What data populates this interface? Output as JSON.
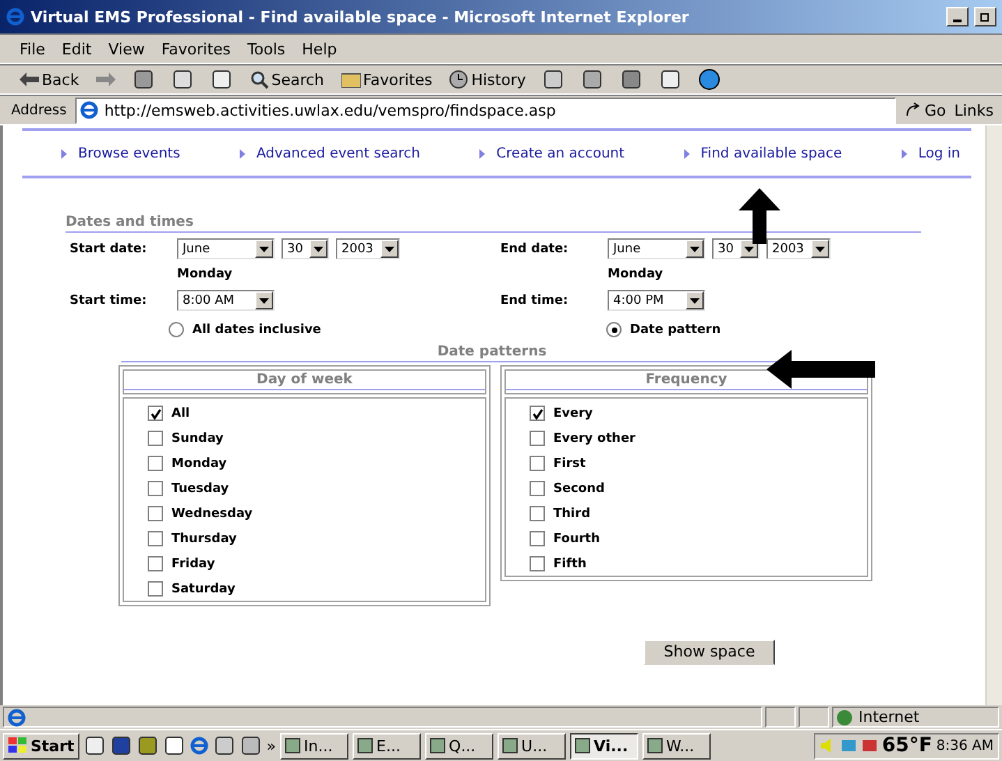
{
  "window": {
    "title": "Virtual EMS Professional - Find available space - Microsoft Internet Explorer"
  },
  "menu": [
    "File",
    "Edit",
    "View",
    "Favorites",
    "Tools",
    "Help"
  ],
  "toolbar": [
    {
      "kind": "back",
      "label": "Back"
    },
    {
      "kind": "search",
      "label": "Search"
    },
    {
      "kind": "favorites",
      "label": "Favorites"
    },
    {
      "kind": "history",
      "label": "History"
    }
  ],
  "address": {
    "label": "Address",
    "url": "http://emsweb.activities.uwlax.edu/vemspro/findspace.asp",
    "go": "Go",
    "links": "Links"
  },
  "nav": [
    {
      "label": "Browse events"
    },
    {
      "label": "Advanced event search"
    },
    {
      "label": "Create an account"
    },
    {
      "label": "Find available space"
    },
    {
      "label": "Log in"
    }
  ],
  "dates": {
    "heading": "Dates and times",
    "start_date": {
      "label": "Start date:",
      "month": "June",
      "day": "30",
      "year": "2003",
      "weekday": "Monday"
    },
    "end_date": {
      "label": "End date:",
      "month": "June",
      "day": "30",
      "year": "2003",
      "weekday": "Monday"
    },
    "start_time": {
      "label": "Start time:",
      "value": "8:00 AM"
    },
    "end_time": {
      "label": "End time:",
      "value": "4:00 PM"
    },
    "modes": [
      {
        "label": "All dates inclusive",
        "selected": false
      },
      {
        "label": "Date pattern",
        "selected": true
      }
    ]
  },
  "patterns": {
    "heading": "Date patterns",
    "panels": [
      {
        "title": "Day of week",
        "items": [
          {
            "label": "All",
            "checked": true
          },
          {
            "label": "Sunday",
            "checked": false
          },
          {
            "label": "Monday",
            "checked": false
          },
          {
            "label": "Tuesday",
            "checked": false
          },
          {
            "label": "Wednesday",
            "checked": false
          },
          {
            "label": "Thursday",
            "checked": false
          },
          {
            "label": "Friday",
            "checked": false
          },
          {
            "label": "Saturday",
            "checked": false
          }
        ]
      },
      {
        "title": "Frequency",
        "items": [
          {
            "label": "Every",
            "checked": true
          },
          {
            "label": "Every other",
            "checked": false
          },
          {
            "label": "First",
            "checked": false
          },
          {
            "label": "Second",
            "checked": false
          },
          {
            "label": "Third",
            "checked": false
          },
          {
            "label": "Fourth",
            "checked": false
          },
          {
            "label": "Fifth",
            "checked": false
          }
        ]
      }
    ]
  },
  "show_button": "Show space",
  "status": {
    "zone": "Internet"
  },
  "taskbar": {
    "start": "Start",
    "more": "»",
    "tasks": [
      {
        "label": "In...",
        "selected": false
      },
      {
        "label": "E...",
        "selected": false
      },
      {
        "label": "Q...",
        "selected": false
      },
      {
        "label": "U...",
        "selected": false
      },
      {
        "label": "Vi...",
        "selected": true
      },
      {
        "label": "W...",
        "selected": false
      }
    ],
    "temperature": "65°F",
    "time": "8:36 AM"
  }
}
